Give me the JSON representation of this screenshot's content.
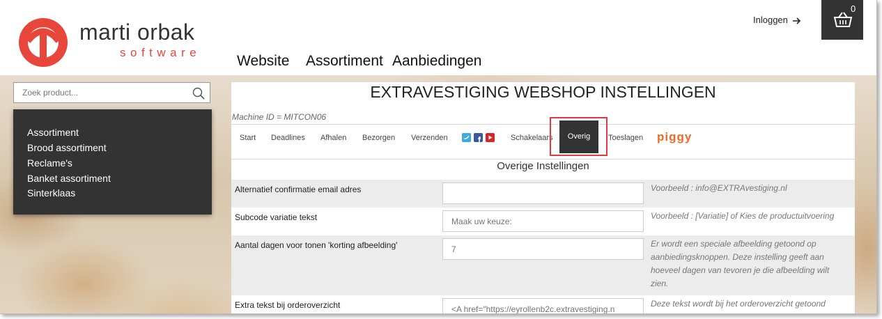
{
  "header": {
    "brand_name": "marti orbak",
    "brand_sub": "software",
    "nav": [
      "Website",
      "Assortiment",
      "Aanbiedingen"
    ],
    "login_label": "Inloggen",
    "cart_count": "0"
  },
  "search": {
    "placeholder": "Zoek product..."
  },
  "sidebar": {
    "items": [
      "Assortiment",
      "Brood assortiment",
      "Reclame's",
      "Banket assortiment",
      "Sinterklaas"
    ]
  },
  "main": {
    "title": "EXTRAVESTIGING WEBSHOP INSTELLINGEN",
    "machine_id": "Machine ID = MITCON06",
    "tabs": [
      "Start",
      "Deadlines",
      "Afhalen",
      "Bezorgen",
      "Verzenden",
      "Schakelaars",
      "Overig",
      "Toeslagen"
    ],
    "active_tab": "Overig",
    "piggy_label": "piggy",
    "section_title": "Overige Instellingen",
    "settings": [
      {
        "label": "Alternatief confirmatie email adres",
        "value": "",
        "placeholder": "",
        "hint": "Voorbeeld : info@EXTRAvestiging.nl"
      },
      {
        "label": "Subcode variatie tekst",
        "value": "",
        "placeholder": "Maak uw keuze:",
        "hint": "Voorbeeld : [Variatie] of Kies de productuitvoering"
      },
      {
        "label": "Aantal dagen voor tonen 'korting afbeelding'",
        "value": "",
        "placeholder": "7",
        "hint": "Er wordt een speciale afbeelding getoond op aanbiedingsknoppen. Deze instelling geeft aan hoeveel dagen van tevoren je die afbeelding wilt zien."
      },
      {
        "label": "Extra tekst bij orderoverzicht",
        "value": "",
        "placeholder": "<A href=\"https://eyrollenb2c.extravestiging.n",
        "hint": "Deze tekst wordt bij het orderoverzicht getoond"
      }
    ]
  },
  "colors": {
    "brand_red": "#e8463b",
    "dark": "#333333",
    "highlight": "#e3393f",
    "piggy": "#f06a22"
  }
}
